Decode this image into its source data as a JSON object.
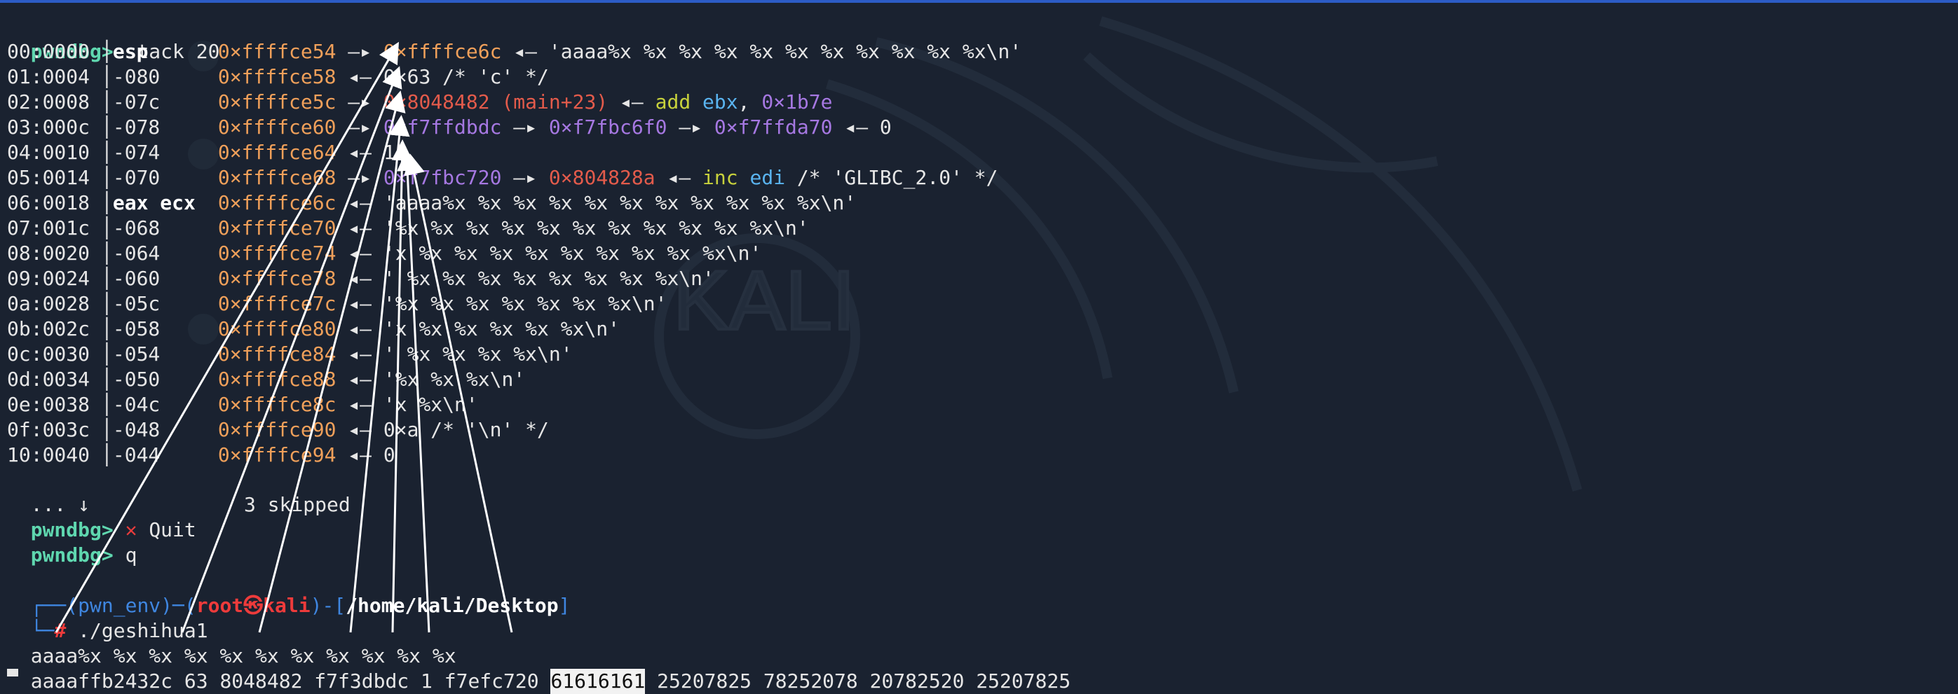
{
  "prompt": "pwndbg>",
  "cmd_stack": "stack 20",
  "stack": [
    {
      "off": "00:0000",
      "rel": "esp",
      "addr": "0×ffffce54",
      "arrow": "—▸",
      "rest": [
        {
          "t": "0×ffffce6c",
          "c": "orange"
        },
        {
          "t": " ◂— 'aaaa%x %x %x %x %x %x %x %x %x %x %x\\n'",
          "c": "white"
        }
      ]
    },
    {
      "off": "01:0004",
      "rel": "-080",
      "addr": "0×ffffce58",
      "arrow": "◂—",
      "rest": [
        {
          "t": "0×63 /* 'c' */",
          "c": "white"
        }
      ]
    },
    {
      "off": "02:0008",
      "rel": "-07c",
      "addr": "0×ffffce5c",
      "arrow": "—▸",
      "rest": [
        {
          "t": "0×8048482 (main+23)",
          "c": "red"
        },
        {
          "t": " ◂— ",
          "c": "white"
        },
        {
          "t": "add",
          "c": "yellow"
        },
        {
          "t": " ",
          "c": "white"
        },
        {
          "t": "ebx",
          "c": "cyan"
        },
        {
          "t": ", ",
          "c": "white"
        },
        {
          "t": "0×1b7e",
          "c": "purple"
        }
      ]
    },
    {
      "off": "03:000c",
      "rel": "-078",
      "addr": "0×ffffce60",
      "arrow": "—▸",
      "rest": [
        {
          "t": "0×f7ffdbdc",
          "c": "purple"
        },
        {
          "t": " —▸ ",
          "c": "white"
        },
        {
          "t": "0×f7fbc6f0",
          "c": "purple"
        },
        {
          "t": " —▸ ",
          "c": "white"
        },
        {
          "t": "0×f7ffda70",
          "c": "purple"
        },
        {
          "t": " ◂— 0",
          "c": "white"
        }
      ]
    },
    {
      "off": "04:0010",
      "rel": "-074",
      "addr": "0×ffffce64",
      "arrow": "◂—",
      "rest": [
        {
          "t": "1",
          "c": "white"
        }
      ]
    },
    {
      "off": "05:0014",
      "rel": "-070",
      "addr": "0×ffffce68",
      "arrow": "—▸",
      "rest": [
        {
          "t": "0×f7fbc720",
          "c": "purple"
        },
        {
          "t": " —▸ ",
          "c": "white"
        },
        {
          "t": "0×804828a",
          "c": "red"
        },
        {
          "t": " ◂— ",
          "c": "white"
        },
        {
          "t": "inc",
          "c": "yellow"
        },
        {
          "t": " ",
          "c": "white"
        },
        {
          "t": "edi",
          "c": "cyan"
        },
        {
          "t": " /* 'GLIBC_2.0' */",
          "c": "white"
        }
      ]
    },
    {
      "off": "06:0018",
      "rel": "eax ecx",
      "addr": "0×ffffce6c",
      "arrow": "◂—",
      "rest": [
        {
          "t": "'aaaa%x %x %x %x %x %x %x %x %x %x %x\\n'",
          "c": "white"
        }
      ]
    },
    {
      "off": "07:001c",
      "rel": "-068",
      "addr": "0×ffffce70",
      "arrow": "◂—",
      "rest": [
        {
          "t": "'%x %x %x %x %x %x %x %x %x %x %x\\n'",
          "c": "white"
        }
      ]
    },
    {
      "off": "08:0020",
      "rel": "-064",
      "addr": "0×ffffce74",
      "arrow": "◂—",
      "rest": [
        {
          "t": "'x %x %x %x %x %x %x %x %x %x\\n'",
          "c": "white"
        }
      ]
    },
    {
      "off": "09:0024",
      "rel": "-060",
      "addr": "0×ffffce78",
      "arrow": "◂—",
      "rest": [
        {
          "t": "' %x %x %x %x %x %x %x %x\\n'",
          "c": "white"
        }
      ]
    },
    {
      "off": "0a:0028",
      "rel": "-05c",
      "addr": "0×ffffce7c",
      "arrow": "◂—",
      "rest": [
        {
          "t": "'%x %x %x %x %x %x %x\\n'",
          "c": "white"
        }
      ]
    },
    {
      "off": "0b:002c",
      "rel": "-058",
      "addr": "0×ffffce80",
      "arrow": "◂—",
      "rest": [
        {
          "t": "'x %x %x %x %x %x\\n'",
          "c": "white"
        }
      ]
    },
    {
      "off": "0c:0030",
      "rel": "-054",
      "addr": "0×ffffce84",
      "arrow": "◂—",
      "rest": [
        {
          "t": "' %x %x %x %x\\n'",
          "c": "white"
        }
      ]
    },
    {
      "off": "0d:0034",
      "rel": "-050",
      "addr": "0×ffffce88",
      "arrow": "◂—",
      "rest": [
        {
          "t": "'%x %x %x\\n'",
          "c": "white"
        }
      ]
    },
    {
      "off": "0e:0038",
      "rel": "-04c",
      "addr": "0×ffffce8c",
      "arrow": "◂—",
      "rest": [
        {
          "t": "'x %x\\n'",
          "c": "white"
        }
      ]
    },
    {
      "off": "0f:003c",
      "rel": "-048",
      "addr": "0×ffffce90",
      "arrow": "◂—",
      "rest": [
        {
          "t": "0×a /* '\\n' */",
          "c": "white"
        }
      ]
    },
    {
      "off": "10:0040",
      "rel": "-044",
      "addr": "0×ffffce94",
      "arrow": "◂—",
      "rest": [
        {
          "t": "0",
          "c": "white"
        }
      ]
    }
  ],
  "skip_marker": "... ↓",
  "skip_text": "3 skipped",
  "quit_icon_glyph": "✕",
  "quit_label": "Quit",
  "cmd_q": "q",
  "shell": {
    "corner1": "┌──",
    "env": "(pwn_env)",
    "dash": "─",
    "paren_open": "(",
    "user": "root㉿kali",
    "paren_close": ")",
    "bracket_open": "-[",
    "path": "/home/kali/Desktop",
    "bracket_close": "]",
    "corner2": "└─",
    "hash": "#",
    "command": "./geshihua1"
  },
  "output_input": "aaaa%x %x %x %x %x %x %x %x %x %x %x",
  "output": {
    "pre": "aaaaffb2432c 63 8048482 f7f3dbdc 1 f7efc720 ",
    "highlight": "61616161",
    "post": " 25207825 78252078 20782520 25207825"
  },
  "colors": {
    "background": "#1a2230",
    "prompt": "#5fd7af",
    "address": "#f0a05a",
    "code": "#e35b4b",
    "data": "#a678e2",
    "accent_bar": "#2c5cc5"
  }
}
